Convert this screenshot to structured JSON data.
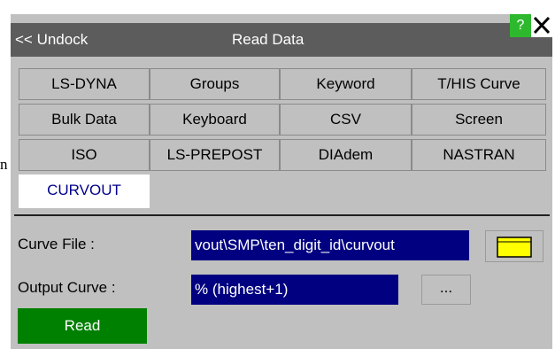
{
  "edge_text": "n",
  "titlebar": {
    "undock_label": "<< Undock",
    "title": "Read Data",
    "help_label": "?",
    "close_label": "✕"
  },
  "tabs": [
    {
      "label": "LS-DYNA"
    },
    {
      "label": "Groups"
    },
    {
      "label": "Keyword"
    },
    {
      "label": "T/HIS Curve"
    },
    {
      "label": "Bulk Data"
    },
    {
      "label": "Keyboard"
    },
    {
      "label": "CSV"
    },
    {
      "label": "Screen"
    },
    {
      "label": "ISO"
    },
    {
      "label": "LS-PREPOST"
    },
    {
      "label": "DIAdem"
    },
    {
      "label": "NASTRAN"
    },
    {
      "label": "CURVOUT",
      "active": true
    }
  ],
  "form": {
    "curve_file_label": "Curve File :",
    "curve_file_value": "vout\\SMP\\ten_digit_id\\curvout",
    "output_curve_label": "Output Curve :",
    "output_curve_value": "% (highest+1)",
    "browse_label": "...",
    "read_label": "Read"
  },
  "colors": {
    "title_bar": "#5c5c5c",
    "panel": "#c0c0c0",
    "field": "#000080",
    "read_button": "#008000",
    "help_button": "#2eb82e",
    "folder": "#ffff00"
  }
}
